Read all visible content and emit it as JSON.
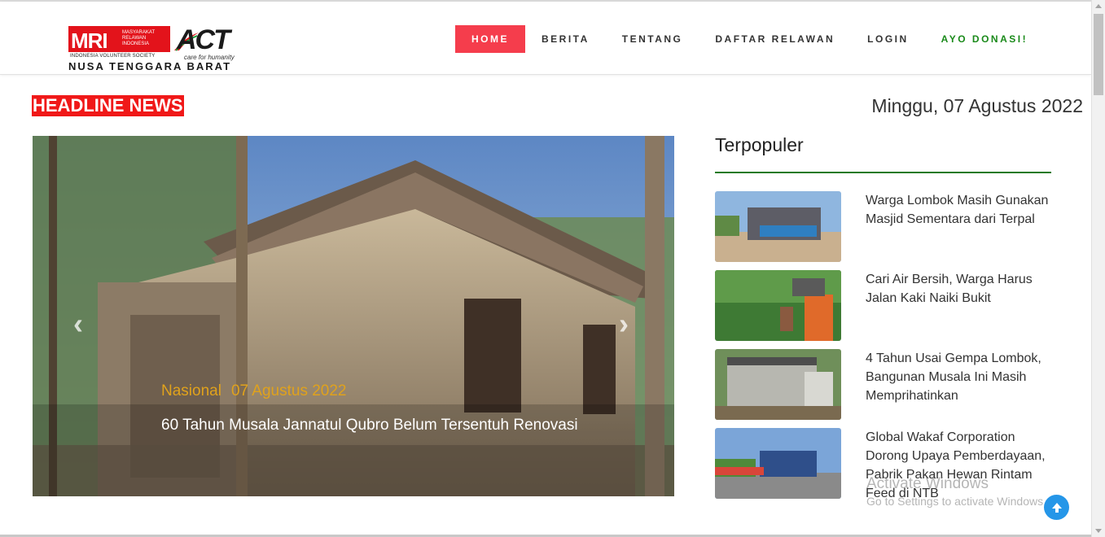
{
  "logo": {
    "mri": "MRI",
    "mri_sub": "MASYARAKAT RELAWAN INDONESIA",
    "ivs": "INDONESIA VOLUNTEER SOCIETY",
    "act": "ACT",
    "care": "care for humanity",
    "region": "NUSA TENGGARA BARAT"
  },
  "nav": {
    "items": [
      "HOME",
      "BERITA",
      "TENTANG",
      "DAFTAR RELAWAN",
      "LOGIN",
      "AYO DONASI!"
    ],
    "active": "HOME"
  },
  "headline": {
    "label": "HEADLINE NEWS",
    "date": "Minggu, 07 Agustus 2022"
  },
  "slider": {
    "category": "Nasional",
    "date": "07 Agustus 2022",
    "title": "60 Tahun Musala Jannatul Qubro Belum Tersentuh Renovasi",
    "prev_glyph": "‹",
    "next_glyph": "›"
  },
  "sidebar": {
    "title": "Terpopuler",
    "items": [
      {
        "title": "Warga Lombok Masih Gunakan Masjid Sementara dari Terpal"
      },
      {
        "title": "Cari Air Bersih, Warga Harus Jalan Kaki Naiki Bukit"
      },
      {
        "title": "4 Tahun Usai Gempa Lombok, Bangunan Musala Ini Masih Memprihatinkan"
      },
      {
        "title": "Global Wakaf Corporation Dorong Upaya Pemberdayaan, Pabrik Pakan Hewan Rintam Feed di NTB"
      }
    ]
  },
  "watermark": {
    "line1": "Activate Windows",
    "line2": "Go to Settings to activate Windows."
  },
  "icons": {
    "scroll_top": "arrow-up-icon"
  }
}
